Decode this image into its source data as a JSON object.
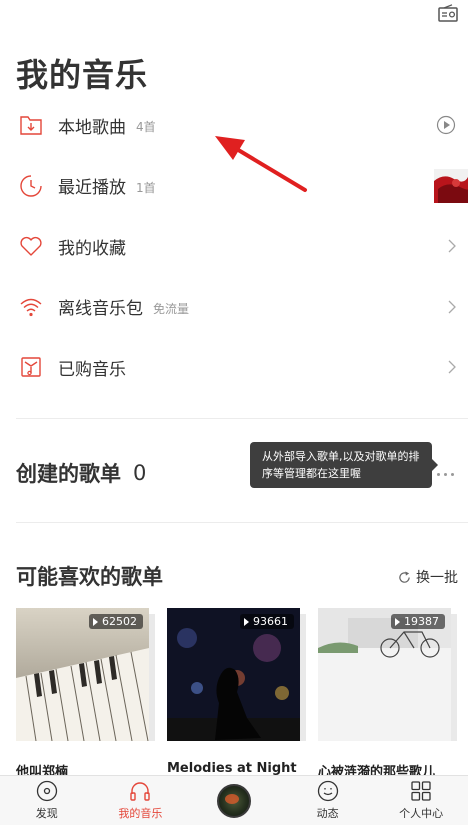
{
  "header": {
    "title": "我的音乐",
    "radio_icon": "radio-icon"
  },
  "menu": [
    {
      "icon": "folder-download-icon",
      "label": "本地歌曲",
      "sub": "4首",
      "right": "play-circle-icon"
    },
    {
      "icon": "clock-icon",
      "label": "最近播放",
      "sub": "1首",
      "right": "album-thumbnail"
    },
    {
      "icon": "heart-icon",
      "label": "我的收藏",
      "sub": "",
      "right": "chevron-right-icon"
    },
    {
      "icon": "wifi-offline-icon",
      "label": "离线音乐包",
      "sub": "免流量",
      "right": "chevron-right-icon"
    },
    {
      "icon": "purchased-music-icon",
      "label": "已购音乐",
      "sub": "",
      "right": "chevron-right-icon"
    }
  ],
  "created": {
    "title": "创建的歌单",
    "count": "0",
    "more_icon": "more-dots-icon"
  },
  "tooltip": {
    "text": "从外部导入歌单,以及对歌单的排序等管理都在这里喔"
  },
  "recommend": {
    "title": "可能喜欢的歌单",
    "refresh_label": "换一批",
    "cards": [
      {
        "plays": "62502",
        "name": "他叫郑楠"
      },
      {
        "plays": "93661",
        "name": "Melodies at Night"
      },
      {
        "plays": "19387",
        "name": "心被涟漪的那些歌儿"
      }
    ]
  },
  "tabs": [
    {
      "icon": "discover-icon",
      "label": "发现",
      "active": false
    },
    {
      "icon": "headphones-icon",
      "label": "我的音乐",
      "active": true
    },
    {
      "icon": "now-playing-disc",
      "label": "",
      "active": false
    },
    {
      "icon": "smiley-icon",
      "label": "动态",
      "active": false
    },
    {
      "icon": "grid-icon",
      "label": "个人中心",
      "active": false
    }
  ],
  "colors": {
    "accent": "#e4473a",
    "annotation_arrow": "#e02020"
  }
}
